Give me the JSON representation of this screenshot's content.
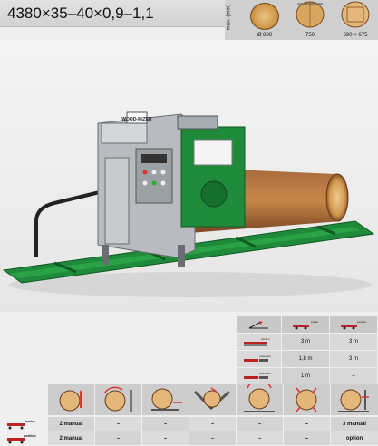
{
  "title": "4380×35–40×0,9–1,1",
  "dims": {
    "axis_label": "max. (mm)",
    "values": [
      "Ø 830",
      "750",
      "690 × 675"
    ]
  },
  "photo": {
    "brand": "WOOD-MIZER",
    "colors": {
      "frame_green": "#1f8a3a",
      "housing_gray": "#9aa0a4",
      "log_wood": "#c8874a",
      "track_yellow": "#e8d23a"
    }
  },
  "length_table": {
    "header_icons": [
      "capacity-icon",
      "loader-icon",
      "position-icon"
    ],
    "rows": [
      {
        "icon": "section-icon",
        "label": "section",
        "col1": "3 m",
        "col2": "3 m"
      },
      {
        "icon": "extension-icon",
        "label": "extension",
        "col1": "1,8 m",
        "col2": "3 m"
      },
      {
        "icon": "extension2-icon",
        "label": "extension",
        "col1": "1 m",
        "col2": "–"
      }
    ]
  },
  "functions": {
    "icons": [
      "log-clamp-icon",
      "log-turner-icon",
      "log-lifter-icon",
      "log-dog-icon",
      "log-rotate-icon",
      "log-level-icon",
      "log-cant-icon"
    ],
    "rows": [
      {
        "icon": "loader-icon",
        "label": "loader",
        "values": [
          "2 manual",
          "–",
          "–",
          "–",
          "–",
          "–",
          "3 manual"
        ]
      },
      {
        "icon": "position-icon",
        "label": "position",
        "values": [
          "2 manual",
          "–",
          "–",
          "–",
          "–",
          "–",
          "option"
        ]
      }
    ]
  }
}
